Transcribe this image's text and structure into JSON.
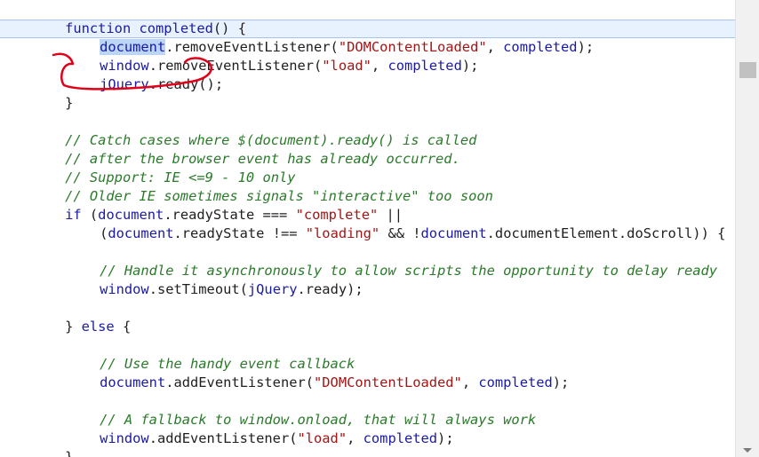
{
  "code": {
    "l1": [
      "function",
      " ",
      "completed",
      "() {"
    ],
    "l2": [
      "document",
      ".removeEventListener(",
      "\"DOMContentLoaded\"",
      ", ",
      "completed",
      ");"
    ],
    "l3": [
      "window",
      ".removeEventListener(",
      "\"load\"",
      ", ",
      "completed",
      ");"
    ],
    "l4": [
      "jQuery",
      ".ready();"
    ],
    "l5": [
      "}"
    ],
    "l7": [
      "// Catch cases where $(document).ready() is called"
    ],
    "l8": [
      "// after the browser event has already occurred."
    ],
    "l9": [
      "// Support: IE <=9 - 10 only"
    ],
    "l10": [
      "// Older IE sometimes signals \"interactive\" too soon"
    ],
    "l11": [
      "if",
      " (",
      "document",
      ".readyState === ",
      "\"complete\"",
      " ||"
    ],
    "l12": [
      "(",
      "document",
      ".readyState !== ",
      "\"loading\"",
      " && !",
      "document",
      ".documentElement.doScroll)) {"
    ],
    "l14": [
      "// Handle it asynchronously to allow scripts the opportunity to delay ready"
    ],
    "l15": [
      "window",
      ".setTimeout(",
      "jQuery",
      ".ready);"
    ],
    "l17": [
      "} ",
      "else",
      " {"
    ],
    "l19": [
      "// Use the handy event callback"
    ],
    "l20": [
      "document",
      ".addEventListener(",
      "\"DOMContentLoaded\"",
      ", ",
      "completed",
      ");"
    ],
    "l22": [
      "// A fallback to window.onload, that will always work"
    ],
    "l23": [
      "window",
      ".addEventListener(",
      "\"load\"",
      ", ",
      "completed",
      ");"
    ],
    "l24": [
      "}"
    ]
  },
  "colors": {
    "keyword": "#1a1aa6",
    "identifier": "#1a1aa6",
    "string": "#a31515",
    "comment": "#2a7a2a",
    "annotation": "#e0001a",
    "highlight": "#e8f2fe"
  },
  "icons": {
    "scroll_down": "scroll-down-arrow-icon"
  }
}
